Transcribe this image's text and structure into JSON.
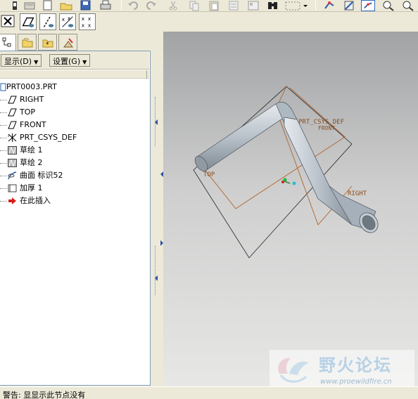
{
  "toolbar": {
    "icons": [
      "disk-icon",
      "open-folder-icon",
      "save-icon",
      "print-icon",
      "undo-icon",
      "redo-icon",
      "cut-icon",
      "copy-icon",
      "paste-icon",
      "regen-icon",
      "find-icon",
      "select-box-icon",
      "datum-display-icon",
      "spin-center-icon",
      "zoom-in-icon",
      "zoom-out-icon"
    ]
  },
  "toolbar2": {
    "icons": [
      "close-window-icon",
      "plane-display-icon",
      "axis-display-icon",
      "point-display-icon",
      "csys-display-icon"
    ]
  },
  "tabs": [
    "model-tree-tab",
    "folder-tab",
    "favorites-tab",
    "connections-tab"
  ],
  "panel": {
    "show_label": "显示(D)",
    "settings_label": "设置(G)"
  },
  "tree": {
    "root": "PRT0003.PRT",
    "items": [
      {
        "label": "RIGHT",
        "icon": "datum-plane-icon"
      },
      {
        "label": "TOP",
        "icon": "datum-plane-icon"
      },
      {
        "label": "FRONT",
        "icon": "datum-plane-icon"
      },
      {
        "label": "PRT_CSYS_DEF",
        "icon": "csys-icon"
      },
      {
        "label": "草绘 1",
        "icon": "sketch-icon"
      },
      {
        "label": "草绘 2",
        "icon": "sketch-icon"
      },
      {
        "label": "曲面 标识52",
        "icon": "surface-icon"
      },
      {
        "label": "加厚 1",
        "icon": "thicken-icon"
      },
      {
        "label": "在此插入",
        "icon": "insert-here-arrow-icon"
      }
    ]
  },
  "viewport": {
    "datum_labels": [
      "PRT_CSYS_DEF",
      "FRONT",
      "TOP",
      "RIGHT"
    ],
    "model_color": "#9ea8b2",
    "datum_color": "#b0632a"
  },
  "status": {
    "text": "警告: 显显示此节点没有"
  },
  "watermark": {
    "title": "野火论坛",
    "url": "www.proewildfire.cn"
  }
}
